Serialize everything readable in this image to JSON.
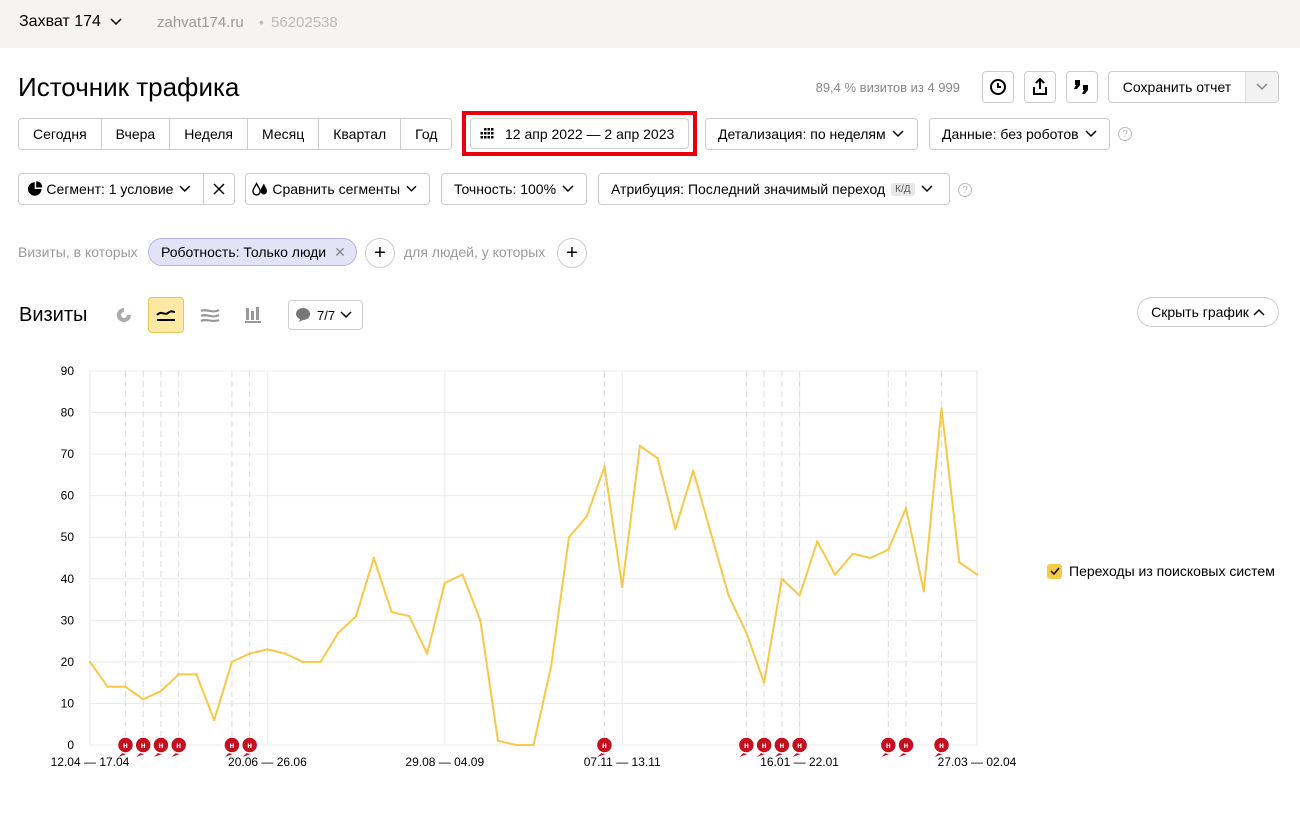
{
  "topbar": {
    "site_name": "Захват 174",
    "domain": "zahvat174.ru",
    "separator": "•",
    "counter_id": "56202538"
  },
  "header": {
    "title": "Источник трафика",
    "visits_share": "89,4 % визитов из 4 999",
    "save_report": "Сохранить отчет",
    "icons": [
      "history-icon",
      "export-icon",
      "quote-icon"
    ]
  },
  "periods": [
    "Сегодня",
    "Вчера",
    "Неделя",
    "Месяц",
    "Квартал",
    "Год"
  ],
  "date_range": "12 апр 2022 — 2 апр 2023",
  "detail": "Детализация: по неделям",
  "data_mode": "Данные: без роботов",
  "segment": "Сегмент: 1 условие",
  "compare": "Сравнить сегменты",
  "accuracy": "Точность: 100%",
  "attribution": "Атрибуция: Последний значимый переход",
  "attribution_badge": "К/Д",
  "help_mark": "?",
  "filters": {
    "prefix": "Визиты, в которых",
    "chip": "Роботность: Только люди",
    "chip_close": "✕",
    "middle": "для людей, у которых",
    "plus": "+"
  },
  "section": {
    "title": "Визиты",
    "notes_count": "7/7",
    "hide_chart": "Скрыть график"
  },
  "colors": {
    "series": "#f6c94a",
    "note": "#c4101e",
    "highlight": "#e8000b"
  },
  "chart_data": {
    "type": "line",
    "y_ticks": [
      "90",
      "80",
      "70",
      "60",
      "50",
      "40",
      "30",
      "20",
      "10",
      "0"
    ],
    "x_tick_labels": [
      "12.04 — 17.04",
      "20.06 — 26.06",
      "29.08 — 04.09",
      "07.11 — 13.11",
      "16.01 — 22.01",
      "27.03 — 02.04"
    ],
    "ylim": [
      0,
      90
    ],
    "series": [
      {
        "name": "Переходы из поисковых систем",
        "values": [
          20,
          14,
          14,
          11,
          13,
          17,
          17,
          6,
          20,
          22,
          23,
          22,
          20,
          20,
          27,
          31,
          45,
          32,
          31,
          22,
          39,
          41,
          30,
          1,
          0,
          0,
          19,
          50,
          55,
          67,
          38,
          72,
          69,
          52,
          66,
          51,
          36,
          27,
          15,
          40,
          36,
          49,
          41,
          46,
          45,
          47,
          57,
          37,
          81,
          44,
          41
        ]
      }
    ],
    "note_mark": "н",
    "note_weeks": [
      2,
      3,
      4,
      5,
      8,
      9,
      29,
      37,
      38,
      39,
      40,
      45,
      46,
      48
    ],
    "grid": true
  }
}
